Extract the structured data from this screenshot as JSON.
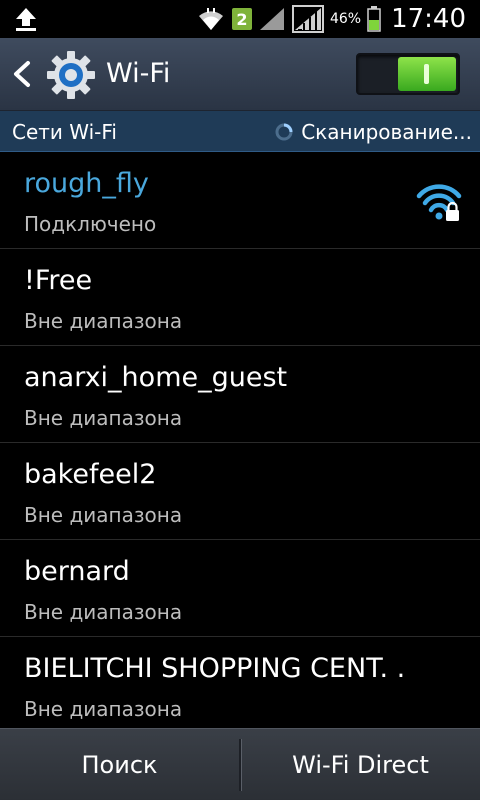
{
  "status_bar": {
    "upload_icon": "upload-arrow-icon",
    "wifi_icon": "wifi-signal-icon",
    "sim_badge": "2",
    "signal_icon": "cell-signal-icon",
    "battery_percent": "46%",
    "battery_icon": "battery-icon",
    "time": "17:40"
  },
  "action_bar": {
    "back_icon": "back-chevron-icon",
    "settings_icon": "gear-icon",
    "title": "Wi-Fi",
    "toggle_state": "on"
  },
  "section": {
    "title": "Сети Wi-Fi",
    "scanning_label": "Сканирование..."
  },
  "networks": [
    {
      "name": "rough_fly",
      "status": "Подключено",
      "connected": true,
      "secured_icon": "wifi-lock-icon"
    },
    {
      "name": "!Free",
      "status": "Вне диапазона",
      "connected": false
    },
    {
      "name": "anarxi_home_guest",
      "status": "Вне диапазона",
      "connected": false
    },
    {
      "name": "bakefeel2",
      "status": "Вне диапазона",
      "connected": false
    },
    {
      "name": "bernard",
      "status": "Вне диапазона",
      "connected": false
    },
    {
      "name": "BIELITCHI SHOPPING CENT. .",
      "status": "Вне диапазона",
      "connected": false
    }
  ],
  "bottom_bar": {
    "search_label": "Поиск",
    "wifi_direct_label": "Wi-Fi Direct"
  },
  "colors": {
    "action_bar": "#2f3a4c",
    "section_header": "#1f3b57",
    "connected_text": "#4aa8dd",
    "toggle_on": "#5bc92c",
    "sim_badge": "#7fb33a"
  }
}
